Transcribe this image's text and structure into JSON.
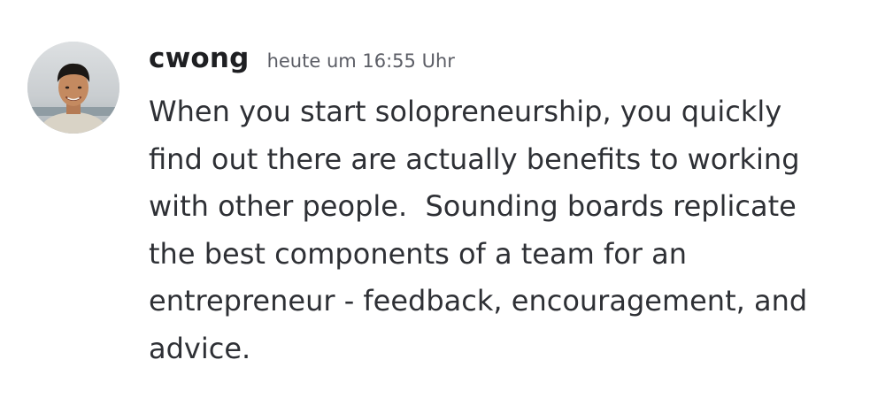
{
  "message": {
    "author": {
      "username": "cwong",
      "avatar_icon": "user-avatar-photo"
    },
    "timestamp": "heute um 16:55 Uhr",
    "lines": [
      "When you start solopreneurship, you quickly",
      "find out there are actually benefits to working",
      "with other people.  Sounding boards replicate",
      "the best components of a team for an",
      "entrepreneur - feedback, encouragement, and",
      "advice."
    ]
  },
  "colors": {
    "background": "#ffffff",
    "username": "#1e1f22",
    "timestamp": "#5c5e66",
    "body_text": "#2e3035"
  }
}
